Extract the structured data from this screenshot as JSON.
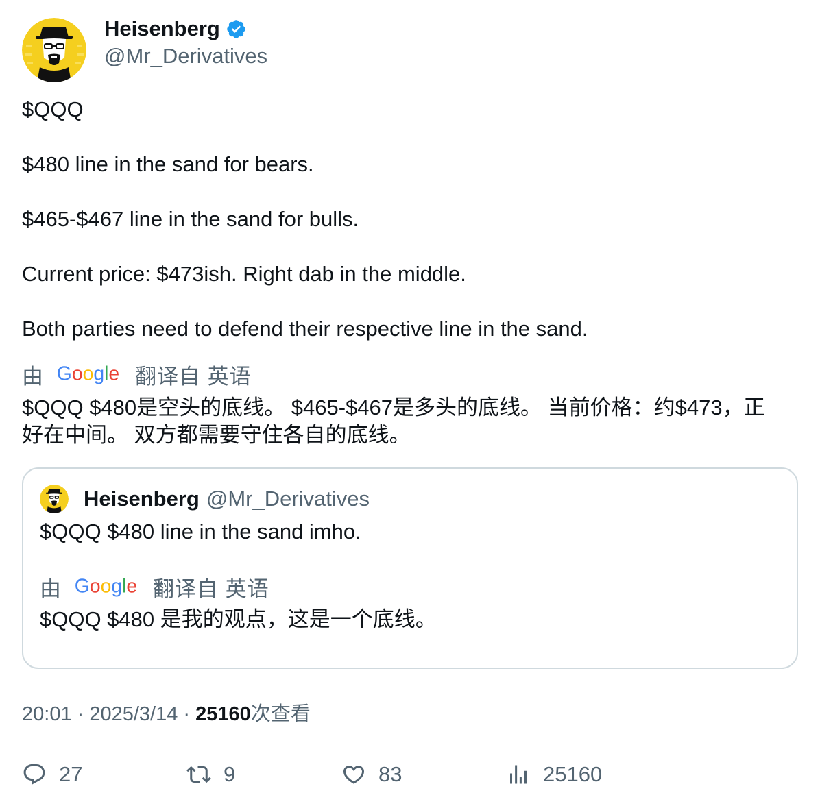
{
  "author": {
    "display_name": "Heisenberg",
    "handle": "@Mr_Derivatives",
    "verified_icon": "verified-badge-icon"
  },
  "tweet": {
    "lines": [
      "$QQQ",
      "$480 line in the sand for bears.",
      "$465-$467 line in the sand for bulls.",
      "Current price: $473ish. Right dab in the middle.",
      "Both parties need to defend their respective line in the sand."
    ],
    "translate": {
      "by": "由",
      "provider": "Google",
      "from": "翻译自 英语"
    },
    "translated_lines": [
      "$QQQ $480是空头的底线。 $465-$467是多头的底线。 当前价格：约$473，正",
      "好在中间。 双方都需要守住各自的底线。"
    ]
  },
  "quote": {
    "display_name": "Heisenberg",
    "handle": "@Mr_Derivatives",
    "text": "$QQQ $480 line in the sand imho.",
    "translate": {
      "by": "由",
      "provider": "Google",
      "from": "翻译自 英语"
    },
    "translated": "$QQQ $480 是我的观点，这是一个底线。"
  },
  "meta": {
    "time": "20:01",
    "sep1": " · ",
    "date": "2025/3/14",
    "sep2": " · ",
    "views_count": "25160",
    "views_label": "次查看"
  },
  "actions": {
    "replies": "27",
    "retweets": "9",
    "likes": "83",
    "views": "25160"
  },
  "colors": {
    "text_primary": "#0f1419",
    "text_secondary": "#536471",
    "border": "#cfd9de",
    "verified_blue": "#1d9bf0",
    "avatar_yellow": "#f5cf1f"
  }
}
